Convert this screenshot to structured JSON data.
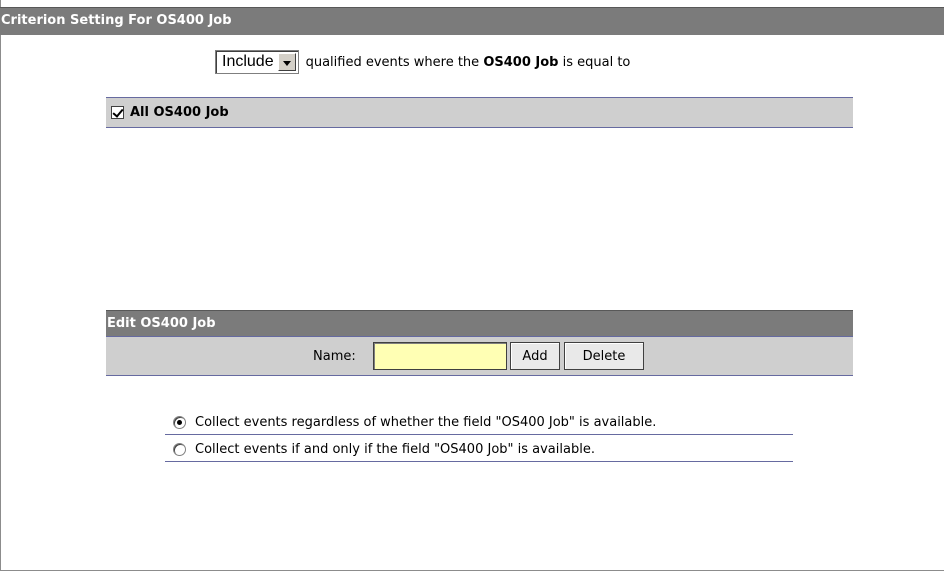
{
  "title": "Criterion Setting For OS400 Job",
  "criteria": {
    "operator": "Include",
    "text_before": "qualified events where the",
    "field": "OS400 Job",
    "text_after": "is equal to"
  },
  "list": {
    "all_label": "All OS400 Job",
    "all_checked": true
  },
  "edit": {
    "header": "Edit OS400 Job",
    "name_label": "Name:",
    "name_value": "",
    "add_label": "Add",
    "delete_label": "Delete"
  },
  "collect_options": [
    {
      "label": "Collect events regardless of whether the field \"OS400 Job\" is available.",
      "selected": true
    },
    {
      "label": "Collect events if and only if the field \"OS400 Job\" is available.",
      "selected": false
    }
  ]
}
